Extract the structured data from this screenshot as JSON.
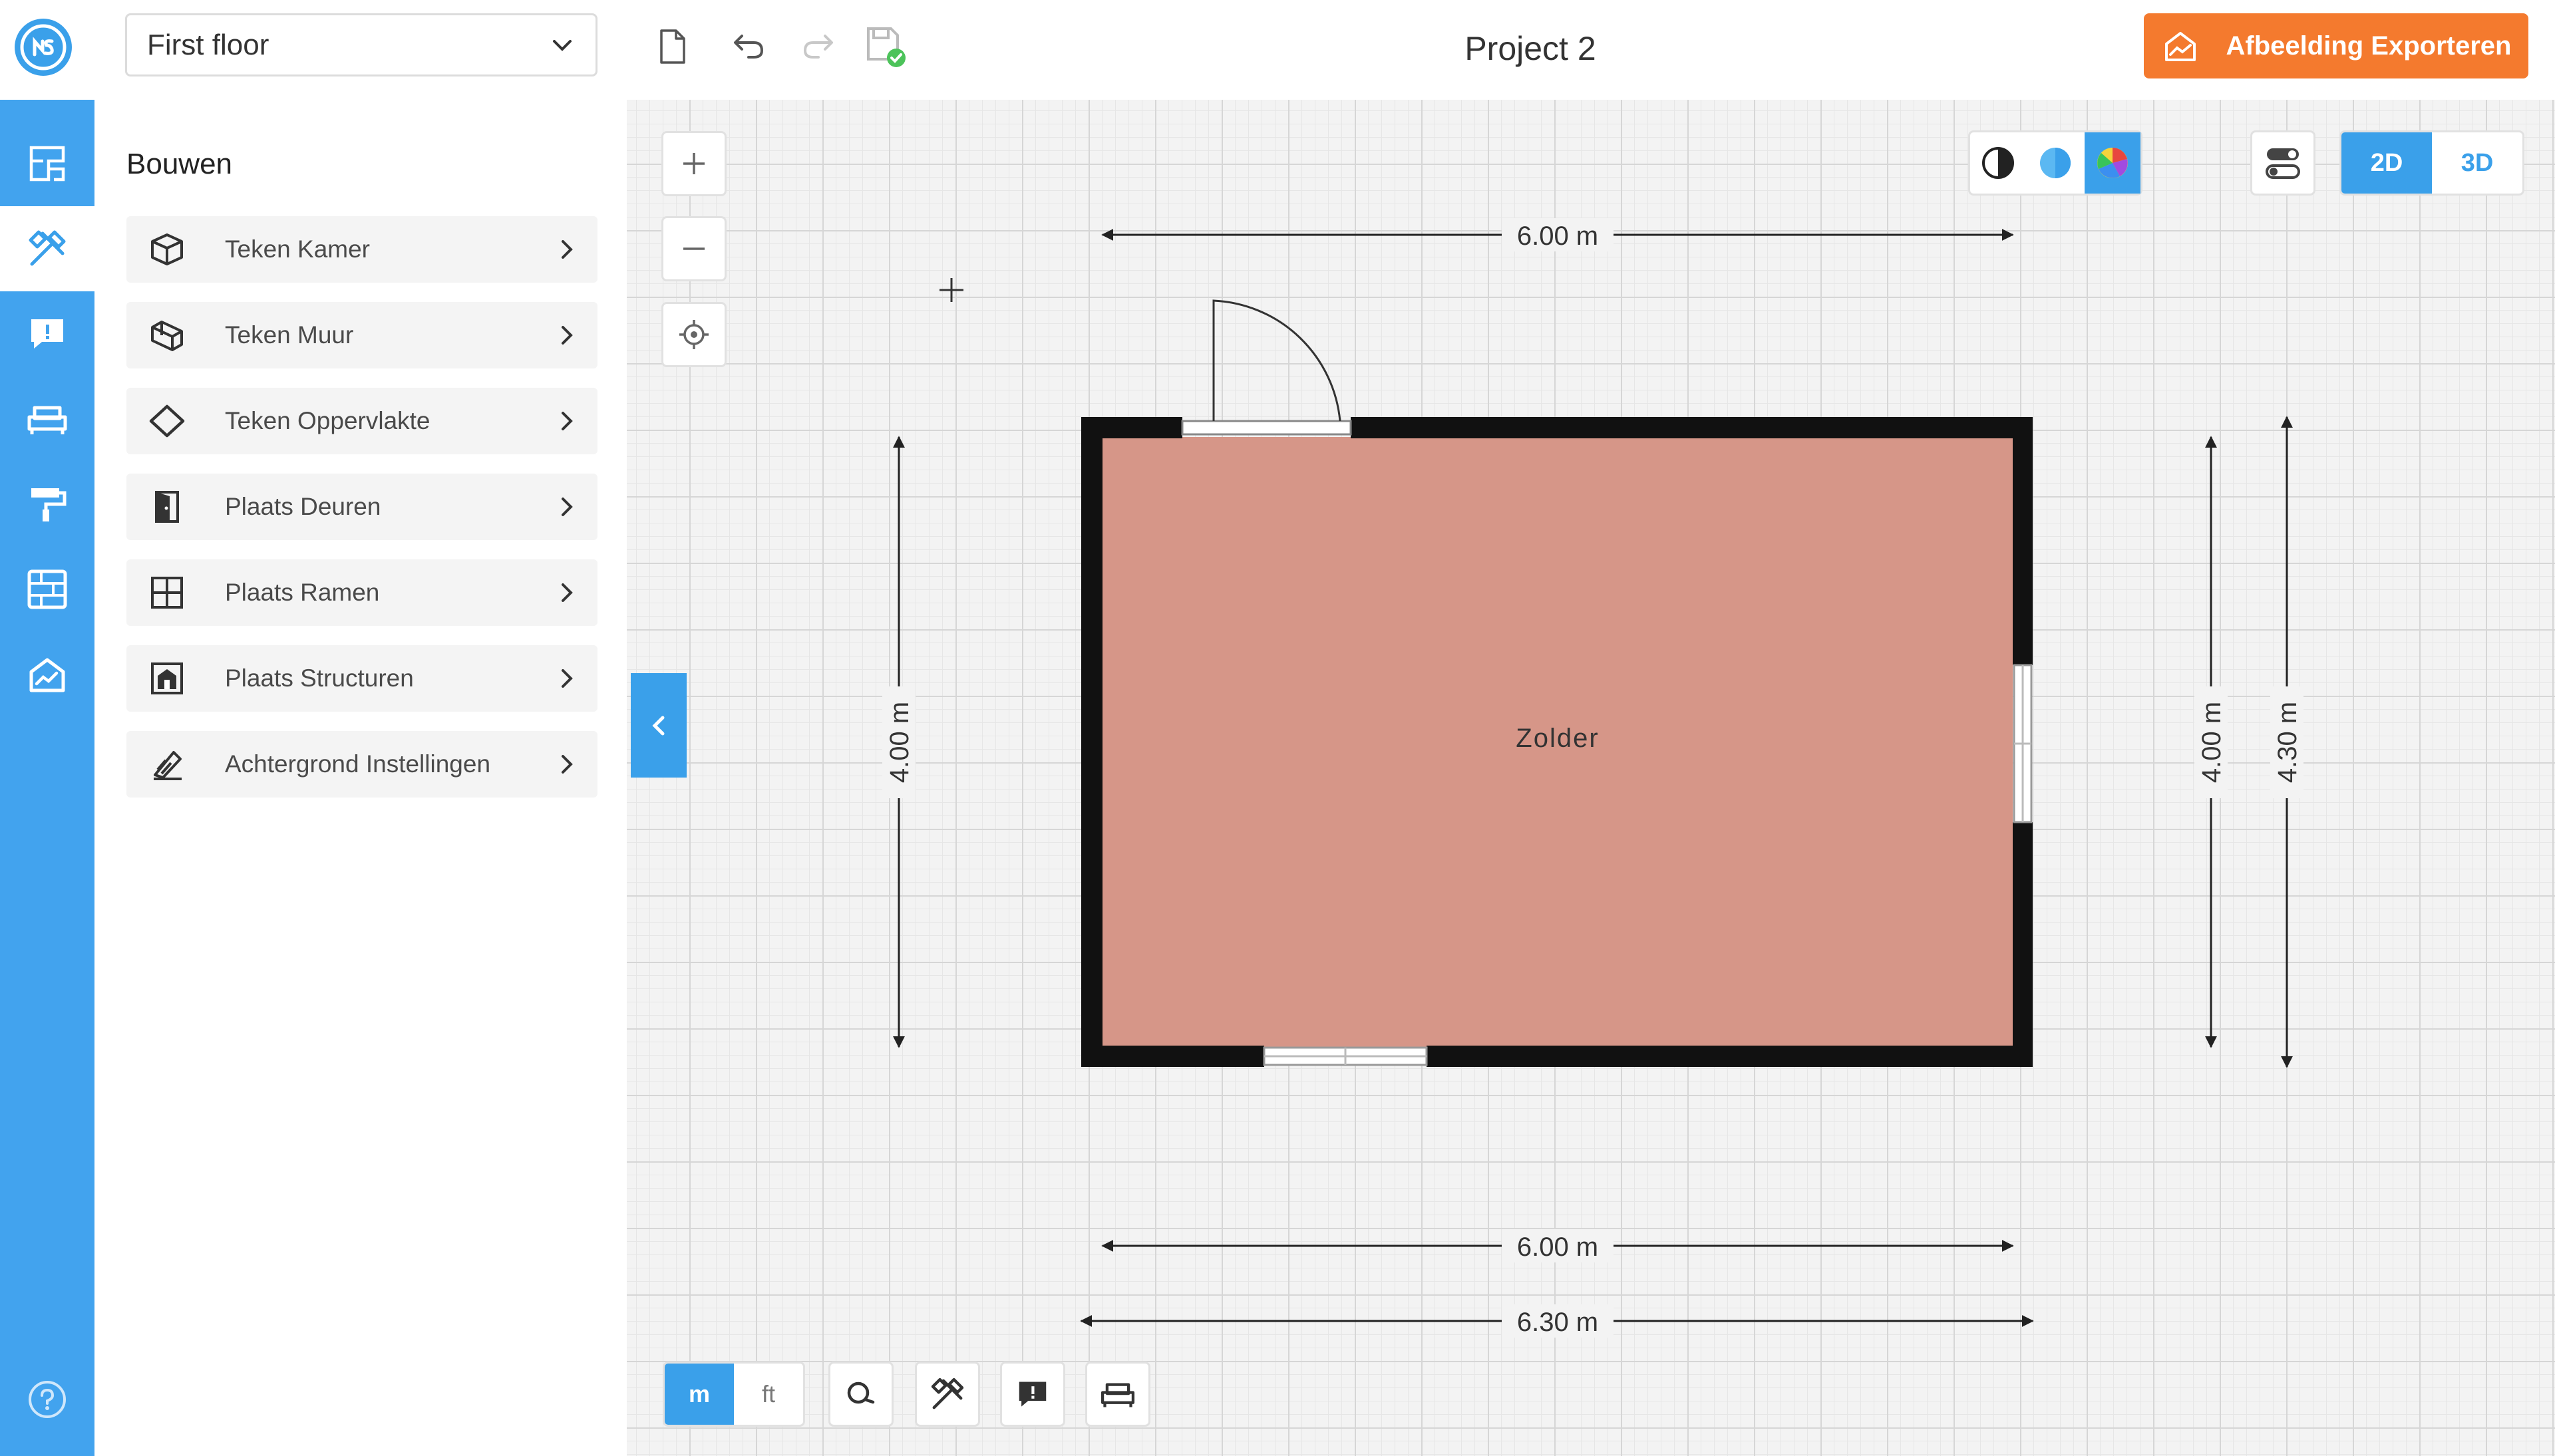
{
  "header": {
    "floor_selector": {
      "value": "First floor"
    },
    "project_title": "Project 2",
    "export_button": {
      "label": "Afbeelding Exporteren"
    }
  },
  "sidebar": {
    "title": "Bouwen",
    "items": [
      {
        "label": "Teken Kamer",
        "icon": "cube-icon"
      },
      {
        "label": "Teken Muur",
        "icon": "wall-icon"
      },
      {
        "label": "Teken Oppervlakte",
        "icon": "diamond-surface-icon"
      },
      {
        "label": "Plaats Deuren",
        "icon": "door-icon"
      },
      {
        "label": "Plaats Ramen",
        "icon": "window-icon"
      },
      {
        "label": "Plaats Structuren",
        "icon": "structure-icon"
      },
      {
        "label": "Achtergrond Instellingen",
        "icon": "background-settings-icon"
      }
    ]
  },
  "rail": {
    "items": [
      "floorplan-icon",
      "build-tools-icon",
      "comments-icon",
      "furniture-icon",
      "paint-roller-icon",
      "materials-icon",
      "export-icon",
      "help-icon"
    ],
    "active": "build-tools-icon"
  },
  "view_toggle": {
    "options": [
      "2D",
      "3D"
    ],
    "selected": "2D"
  },
  "units": {
    "options": [
      "m",
      "ft"
    ],
    "selected": "m"
  },
  "floorplan": {
    "room_label": "Zolder",
    "room_color": "#d69688",
    "dimensions": {
      "top": "6.00 m",
      "bottom_inner": "6.00 m",
      "bottom_outer": "6.30 m",
      "left": "4.00 m",
      "right_inner": "4.00 m",
      "right_outer": "4.30 m"
    }
  },
  "colors": {
    "accent": "#42a3ee",
    "export": "#f47a2e",
    "wall": "#111111"
  }
}
